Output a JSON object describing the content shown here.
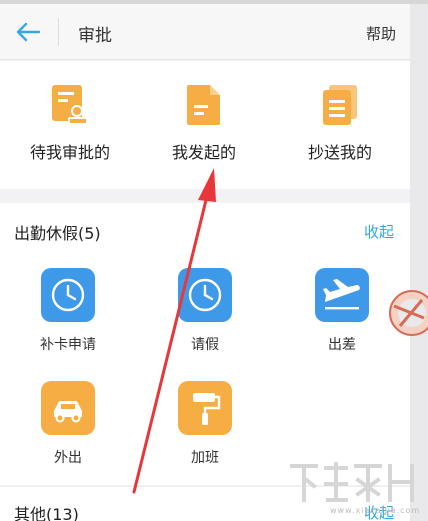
{
  "header": {
    "title": "审批",
    "help_label": "帮助"
  },
  "top_actions": [
    {
      "label": "待我审批的",
      "icon": "pending-approval-icon"
    },
    {
      "label": "我发起的",
      "icon": "document-icon"
    },
    {
      "label": "抄送我的",
      "icon": "cc-files-icon"
    }
  ],
  "attendance": {
    "title": "出勤休假(5)",
    "toggle_label": "收起",
    "items": [
      {
        "label": "补卡申请",
        "icon": "clock-icon",
        "color": "#3e9ae8"
      },
      {
        "label": "请假",
        "icon": "clock-icon",
        "color": "#3e9ae8"
      },
      {
        "label": "出差",
        "icon": "airplane-icon",
        "color": "#3e9ae8"
      },
      {
        "label": "外出",
        "icon": "car-icon",
        "color": "#f6ad43"
      },
      {
        "label": "加班",
        "icon": "paint-roller-icon",
        "color": "#f6ad43"
      }
    ]
  },
  "other": {
    "title": "其他(13)",
    "toggle_label": "收起"
  },
  "watermark": {
    "url": "www.xiazaiba.com"
  },
  "colors": {
    "accent": "#35a8e3",
    "icon_blue": "#3e9ae8",
    "icon_orange": "#f6ad43",
    "annotation_arrow": "#e8373a"
  }
}
